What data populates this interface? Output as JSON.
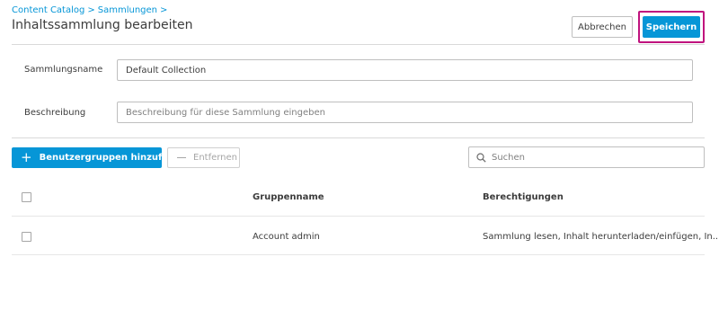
{
  "breadcrumb": {
    "items": [
      "Content Catalog",
      "Sammlungen"
    ],
    "separator": ">"
  },
  "header": {
    "title": "Inhaltssammlung bearbeiten",
    "cancel_label": "Abbrechen",
    "save_label": "Speichern"
  },
  "form": {
    "name_label": "Sammlungsname",
    "name_value": "Default Collection",
    "description_label": "Beschreibung",
    "description_placeholder": "Beschreibung für diese Sammlung eingeben"
  },
  "toolbar": {
    "add_label": "Benutzergruppen hinzufügen",
    "remove_label": "Entfernen",
    "search_placeholder": "Suchen"
  },
  "table": {
    "columns": [
      "Gruppenname",
      "Berechtigungen"
    ],
    "rows": [
      {
        "group": "Account admin",
        "permissions": "Sammlung lesen, Inhalt herunterladen/einfügen, In..."
      }
    ]
  },
  "colors": {
    "accent": "#0696d7",
    "highlight": "#c0137e"
  }
}
